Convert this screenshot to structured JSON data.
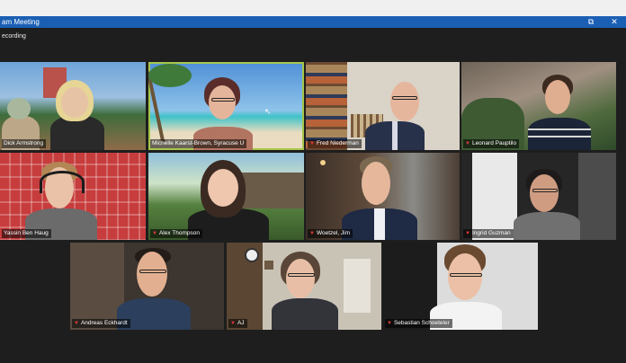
{
  "window": {
    "title": "am Meeting",
    "restore_icon": "restore-icon",
    "close_icon": "close-icon",
    "restore_glyph": "⧉",
    "close_glyph": "✕",
    "accent": "#1a5fb4"
  },
  "status": {
    "recording": "ecording"
  },
  "participants": [
    {
      "name": "Dick Armstrong",
      "muted": false
    },
    {
      "name": "Michelle Kaarst-Brown, Syracuse U",
      "muted": false,
      "active": true
    },
    {
      "name": "Fred Niederman",
      "muted": true
    },
    {
      "name": "Leonard Pauptilo",
      "muted": true
    },
    {
      "name": "Yassin Ben Haug",
      "muted": false
    },
    {
      "name": "Alex Thompson",
      "muted": true
    },
    {
      "name": "Woetzel, Jim",
      "muted": true
    },
    {
      "name": "Ingrid Guzman",
      "muted": true
    },
    {
      "name": "Andreas Eckhardt",
      "muted": true
    },
    {
      "name": "AJ",
      "muted": true
    },
    {
      "name": "Sebastian Schoeteler",
      "muted": true
    }
  ],
  "mic_icon": "mic-muted-icon",
  "mic_glyph": "▼"
}
